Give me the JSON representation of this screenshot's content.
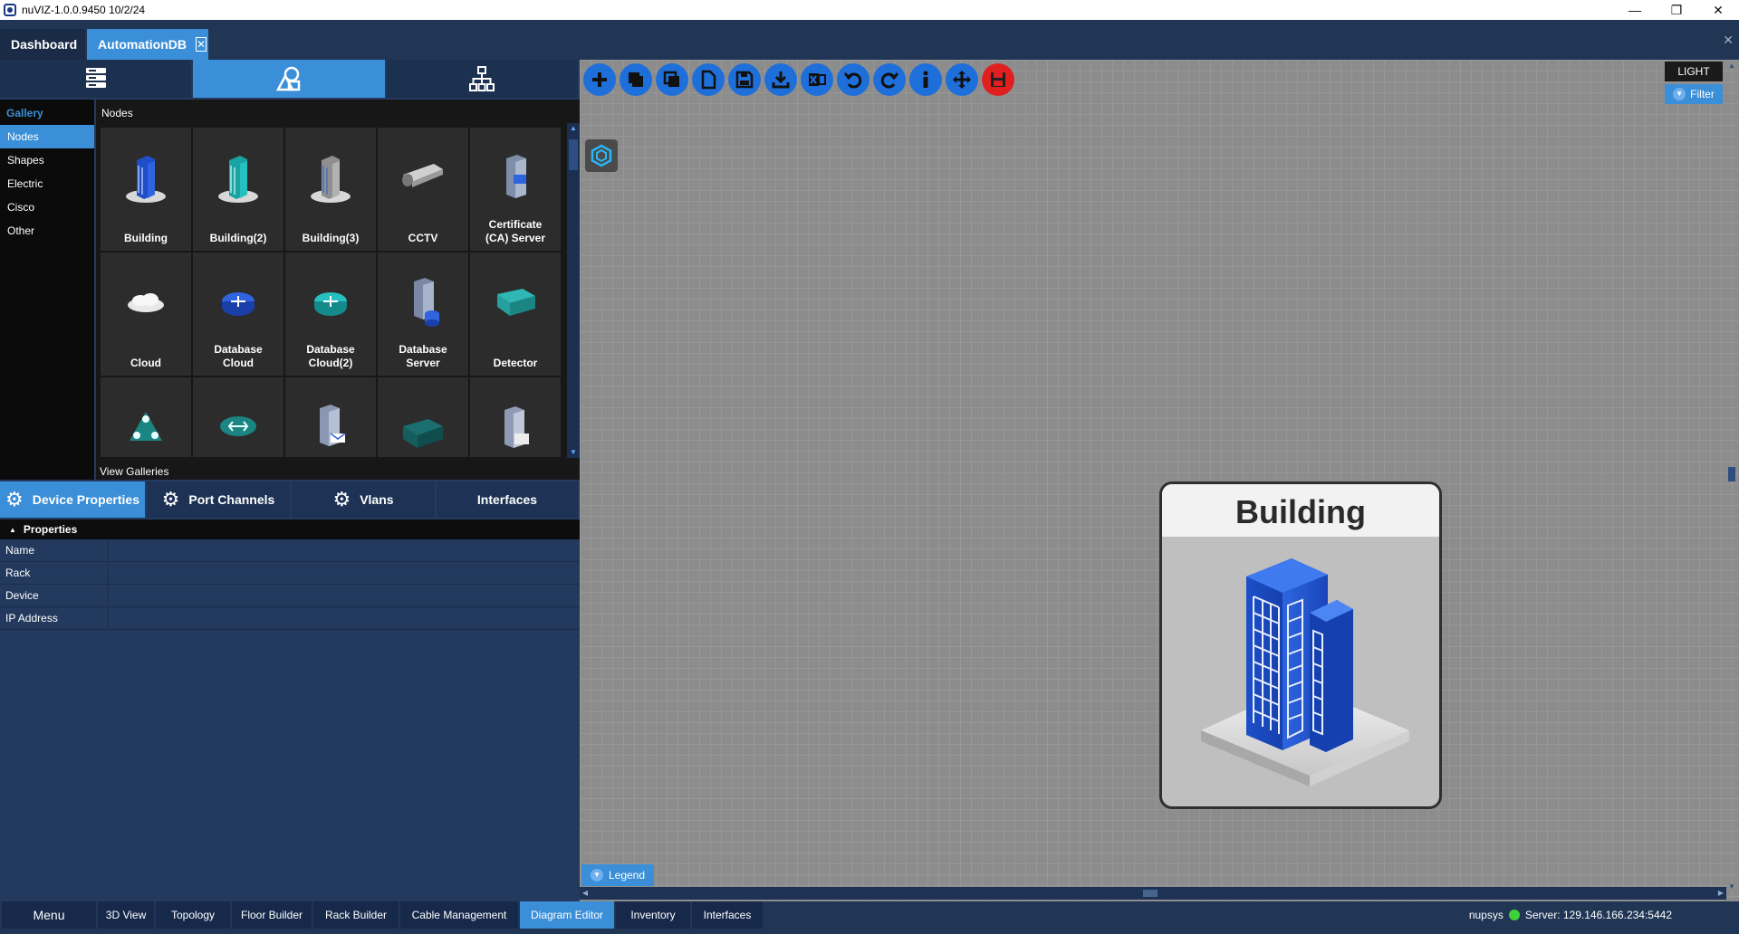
{
  "window": {
    "title": "nuVIZ-1.0.0.9450 10/2/24",
    "controls": [
      "—",
      "❐",
      "✕"
    ]
  },
  "doc_tabs": [
    {
      "label": "Dashboard"
    },
    {
      "label": "AutomationDB"
    }
  ],
  "doc_close": "✕",
  "gallery": {
    "sidebar_title": "Gallery",
    "categories": [
      "Nodes",
      "Shapes",
      "Electric",
      "Cisco",
      "Other"
    ],
    "selected": "Nodes",
    "section_title": "Nodes",
    "items": [
      {
        "label": "Building",
        "icon": "building-blue-icon"
      },
      {
        "label": "Building(2)",
        "icon": "building-teal-icon"
      },
      {
        "label": "Building(3)",
        "icon": "building-gray-icon"
      },
      {
        "label": "CCTV",
        "icon": "cctv-icon"
      },
      {
        "label": "Certificate\n(CA) Server",
        "icon": "certificate-server-icon"
      },
      {
        "label": "Cloud",
        "icon": "cloud-icon"
      },
      {
        "label": "Database\nCloud",
        "icon": "database-cloud-icon"
      },
      {
        "label": "Database\nCloud(2)",
        "icon": "database-cloud-teal-icon"
      },
      {
        "label": "Database\nServer",
        "icon": "database-server-icon"
      },
      {
        "label": "Detector",
        "icon": "detector-icon"
      },
      {
        "label": "",
        "icon": "triangle-network-icon"
      },
      {
        "label": "",
        "icon": "router-teal-icon"
      },
      {
        "label": "",
        "icon": "mail-server-icon"
      },
      {
        "label": "",
        "icon": "teal-box-icon"
      },
      {
        "label": "",
        "icon": "file-server-icon"
      }
    ],
    "footer": "View Galleries"
  },
  "property_tabs": [
    {
      "label": "Device Properties",
      "active": true
    },
    {
      "label": "Port Channels"
    },
    {
      "label": "Vlans"
    },
    {
      "label": "Interfaces"
    }
  ],
  "properties": {
    "header": "Properties",
    "rows": [
      {
        "key": "Name",
        "value": ""
      },
      {
        "key": "Rack",
        "value": ""
      },
      {
        "key": "Device",
        "value": ""
      },
      {
        "key": "IP Address",
        "value": ""
      }
    ]
  },
  "canvas": {
    "theme_button": "LIGHT",
    "filter_button": "Filter",
    "legend_button": "Legend",
    "node": {
      "title": "Building"
    }
  },
  "bottom_tabs": [
    {
      "label": "Menu"
    },
    {
      "label": "3D View"
    },
    {
      "label": "Topology"
    },
    {
      "label": "Floor Builder"
    },
    {
      "label": "Rack Builder"
    },
    {
      "label": "Cable Management"
    },
    {
      "label": "Diagram Editor",
      "active": true
    },
    {
      "label": "Inventory"
    },
    {
      "label": "Interfaces"
    }
  ],
  "status": {
    "user": "nupsys",
    "server": "Server: 129.146.166.234:5442",
    "color": "#3fd13a"
  },
  "colors": {
    "accent": "#3a8fd8",
    "panel": "#243a5e",
    "toolbar_blue": "#1e6fd9",
    "toolbar_red": "#e02020"
  }
}
